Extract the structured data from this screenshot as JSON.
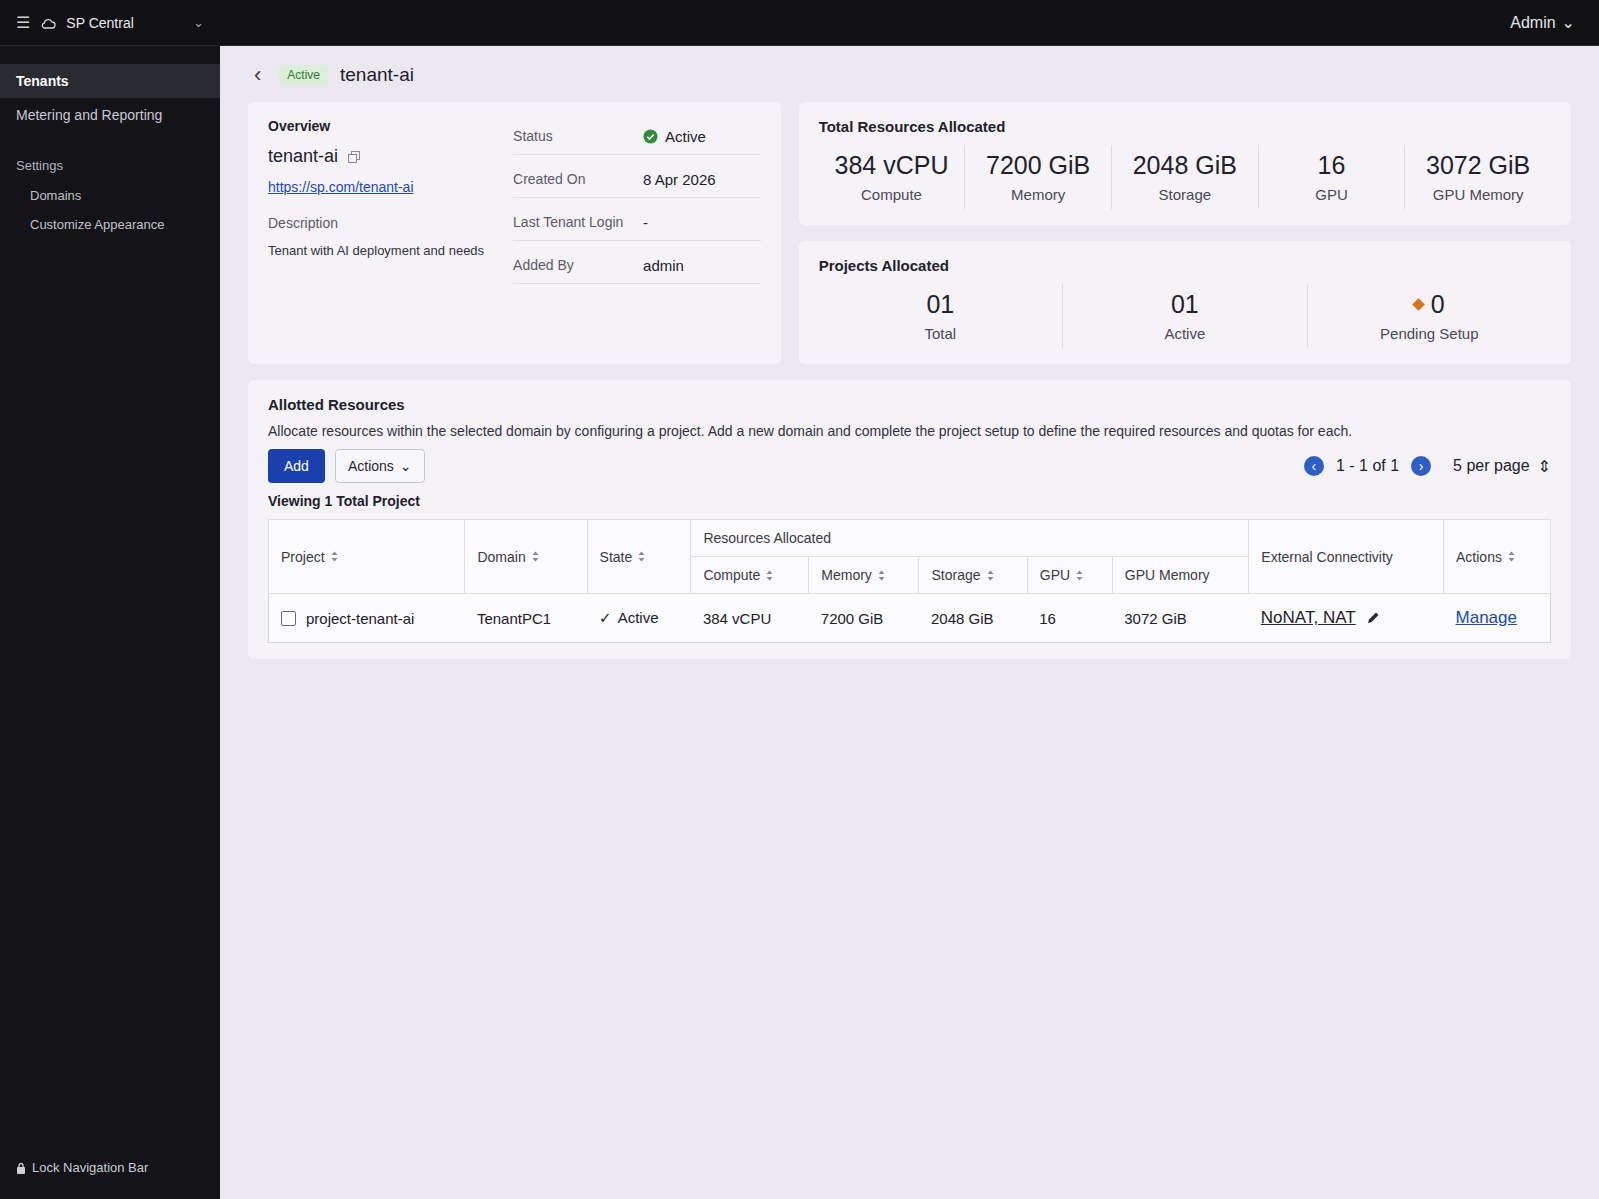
{
  "topbar": {
    "user": "Admin",
    "user_caret": "⌄"
  },
  "sidebar": {
    "menu_icon": "☰",
    "title": "SP Central",
    "title_caret": "⌄",
    "items": [
      {
        "label": "Tenants",
        "selected": true
      },
      {
        "label": "Metering and Reporting",
        "selected": false
      }
    ],
    "settings_label": "Settings",
    "settings_items": [
      {
        "label": "Domains",
        "selected": false
      },
      {
        "label": "Customize Appearance",
        "selected": false
      }
    ],
    "lock": "Lock Navigation Bar"
  },
  "header": {
    "back": "‹",
    "badge": "Active",
    "name": "tenant-ai"
  },
  "overview": {
    "title": "Overview",
    "name": "tenant-ai",
    "url": "https://sp.com/tenant-ai",
    "description_label": "Description",
    "description": "Tenant with AI deployment and needs",
    "fields": [
      {
        "label": "Status",
        "value": "Active",
        "kind": "status"
      },
      {
        "label": "Created On",
        "value": "8 Apr 2026",
        "kind": "text"
      },
      {
        "label": "Last Tenant Login",
        "value": "-",
        "kind": "text"
      },
      {
        "label": "Added By",
        "value": "admin",
        "kind": "text"
      }
    ]
  },
  "resources": {
    "title": "Total Resources Allocated",
    "items": [
      {
        "value": "384 vCPU",
        "label": "Compute"
      },
      {
        "value": "7200 GiB",
        "label": "Memory"
      },
      {
        "value": "2048 GiB",
        "label": "Storage"
      },
      {
        "value": "16",
        "label": "GPU"
      },
      {
        "value": "3072 GiB",
        "label": "GPU Memory"
      }
    ]
  },
  "projects": {
    "title": "Projects Allocated",
    "items": [
      {
        "value": "01",
        "label": "Total",
        "kind": "plain"
      },
      {
        "value": "01",
        "label": "Active",
        "kind": "plain"
      },
      {
        "value": "0",
        "label": "Pending Setup",
        "kind": "pending"
      }
    ]
  },
  "allotted": {
    "title": "Allotted Resources",
    "description": "Allocate resources within the selected domain by configuring a project. Add a new domain and complete the project setup to define the required resources and quotas for each.",
    "add": "Add",
    "actions": "Actions",
    "actions_caret": "⌄",
    "viewing": "Viewing 1 Total Project",
    "pagination": {
      "prev": "‹",
      "range": "1 - 1 of 1",
      "next": "›",
      "per_page": "5 per page",
      "per_page_caret": "⇕"
    }
  },
  "table": {
    "group_header": "Resources Allocated",
    "columns": [
      {
        "label": "Project",
        "sortable": true
      },
      {
        "label": "Domain",
        "sortable": true
      },
      {
        "label": "State",
        "sortable": true
      },
      {
        "label": "Compute",
        "sortable": true
      },
      {
        "label": "Memory",
        "sortable": true
      },
      {
        "label": "Storage",
        "sortable": true
      },
      {
        "label": "GPU",
        "sortable": true
      },
      {
        "label": "GPU Memory",
        "sortable": false
      },
      {
        "label": "External Connectivity",
        "sortable": false
      },
      {
        "label": "Actions",
        "sortable": true
      }
    ],
    "rows": [
      {
        "checked": false,
        "project": "project-tenant-ai",
        "domain": "TenantPC1",
        "state_icon": "✓",
        "state": "Active",
        "compute": "384 vCPU",
        "memory": "7200 GiB",
        "storage": "2048 GiB",
        "gpu": "16",
        "gpu_memory": "3072 GiB",
        "connectivity": "NoNAT, NAT",
        "action": "Manage"
      }
    ]
  }
}
